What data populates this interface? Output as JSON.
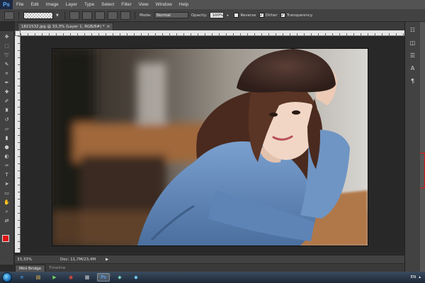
{
  "app": {
    "logo": "Ps"
  },
  "menu": [
    "File",
    "Edit",
    "Image",
    "Layer",
    "Type",
    "Select",
    "Filter",
    "View",
    "Window",
    "Help"
  ],
  "options": {
    "mode_label": "Mode:",
    "mode_value": "Normal",
    "opacity_label": "Opacity:",
    "opacity_value": "100%",
    "reverse_label": "Reverse",
    "dither_label": "Dither",
    "transparency_label": "Transparency",
    "reverse_checked": false,
    "dither_checked": true,
    "transparency_checked": true
  },
  "document": {
    "tab_title": "1821532.jpg @ 33,3% (Layer 1, RGB/8#) *",
    "close_glyph": "×"
  },
  "status": {
    "zoom": "33,33%",
    "doc_info": "Doc: 11,7M/23,4M",
    "arrow": "▶"
  },
  "bottom_panel": {
    "tabs": [
      "Mini Bridge",
      "Timeline"
    ]
  },
  "colors": {
    "foreground": "#e01010",
    "background": "#000000"
  },
  "taskbar": {
    "lang": "EN"
  }
}
